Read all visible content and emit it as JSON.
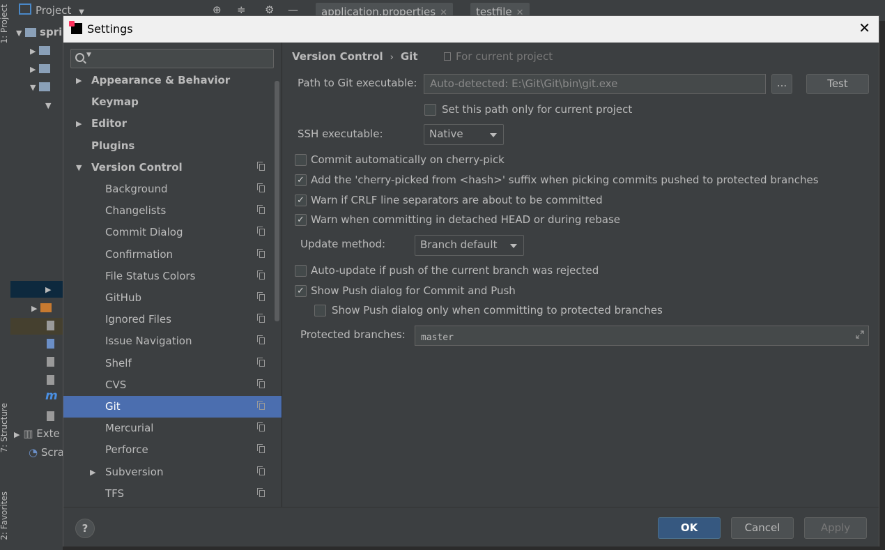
{
  "ide": {
    "project_label": "Project",
    "tabs": [
      {
        "label": "application.properties"
      },
      {
        "label": "testfile"
      }
    ],
    "side_tabs": {
      "project": "1: Project",
      "structure": "7: Structure",
      "favorites": "2: Favorites"
    },
    "tree": {
      "root": "spri",
      "external": "Exte",
      "scratches": "Scra"
    }
  },
  "dialog": {
    "title": "Settings",
    "search_placeholder": "",
    "nav": [
      {
        "label": "Appearance & Behavior",
        "bold": true,
        "arrow": "right",
        "indent": 0
      },
      {
        "label": "Keymap",
        "bold": true,
        "indent": 0
      },
      {
        "label": "Editor",
        "bold": true,
        "arrow": "right",
        "indent": 0
      },
      {
        "label": "Plugins",
        "bold": true,
        "indent": 0
      },
      {
        "label": "Version Control",
        "bold": true,
        "arrow": "down",
        "indent": 0,
        "project_icon": true
      },
      {
        "label": "Background",
        "indent": 1,
        "project_icon": true
      },
      {
        "label": "Changelists",
        "indent": 1,
        "project_icon": true
      },
      {
        "label": "Commit Dialog",
        "indent": 1,
        "project_icon": true
      },
      {
        "label": "Confirmation",
        "indent": 1,
        "project_icon": true
      },
      {
        "label": "File Status Colors",
        "indent": 1,
        "project_icon": true
      },
      {
        "label": "GitHub",
        "indent": 1,
        "project_icon": true
      },
      {
        "label": "Ignored Files",
        "indent": 1,
        "project_icon": true
      },
      {
        "label": "Issue Navigation",
        "indent": 1,
        "project_icon": true
      },
      {
        "label": "Shelf",
        "indent": 1,
        "project_icon": true
      },
      {
        "label": "CVS",
        "indent": 1,
        "project_icon": true
      },
      {
        "label": "Git",
        "indent": 1,
        "project_icon": true,
        "selected": true
      },
      {
        "label": "Mercurial",
        "indent": 1,
        "project_icon": true
      },
      {
        "label": "Perforce",
        "indent": 1,
        "project_icon": true
      },
      {
        "label": "Subversion",
        "indent": 1,
        "project_icon": true,
        "arrow": "right"
      },
      {
        "label": "TFS",
        "indent": 1,
        "project_icon": true
      }
    ],
    "breadcrumb": {
      "parent": "Version Control",
      "separator": "›",
      "current": "Git"
    },
    "scope_note": "For current project",
    "git": {
      "path_label": "Path to Git executable:",
      "path_value": "Auto-detected: E:\\Git\\Git\\bin\\git.exe",
      "browse_label": "...",
      "test_label": "Test",
      "path_only_project": {
        "label": "Set this path only for current project",
        "checked": false
      },
      "ssh_label": "SSH executable:",
      "ssh_value": "Native",
      "options": [
        {
          "label": "Commit automatically on cherry-pick",
          "checked": false
        },
        {
          "label": "Add the 'cherry-picked from <hash>' suffix when picking commits pushed to protected branches",
          "checked": true
        },
        {
          "label": "Warn if CRLF line separators are about to be committed",
          "checked": true
        },
        {
          "label": "Warn when committing in detached HEAD or during rebase",
          "checked": true
        }
      ],
      "update_label": "Update method:",
      "update_value": "Branch default",
      "auto_update": {
        "label": "Auto-update if push of the current branch was rejected",
        "checked": false
      },
      "show_push": {
        "label": "Show Push dialog for Commit and Push",
        "checked": true
      },
      "show_push_protected": {
        "label": "Show Push dialog only when committing to protected branches",
        "checked": false
      },
      "protected_label": "Protected branches:",
      "protected_value": "master"
    },
    "footer": {
      "help_label": "?",
      "ok_label": "OK",
      "cancel_label": "Cancel",
      "apply_label": "Apply"
    }
  },
  "colors": {
    "selection": "#4b6eaf",
    "ok_button": "#365880",
    "dialog_bg": "#3c3f41",
    "title_bar": "#f0f0f0"
  }
}
